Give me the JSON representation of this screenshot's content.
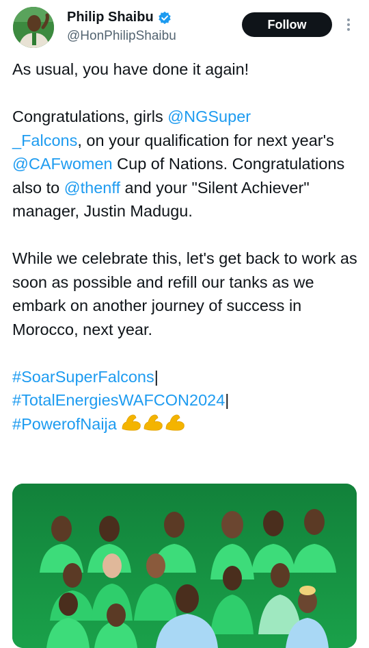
{
  "author": {
    "display_name": "Philip Shaibu",
    "handle": "@HonPhilipShaibu",
    "verified": true,
    "avatar_icon": "avatar-photo"
  },
  "follow_label": "Follow",
  "more_icon": "vertical-dots-icon",
  "tweet": {
    "p1": "As usual, you have done it again!",
    "p2_a": "Congratulations, girls ",
    "p2_mention1a": "@NGSuper",
    "p2_mention1b": "_Falcons",
    "p2_b": ", on your qualification for next year's ",
    "p2_mention2": "@CAFwomen",
    "p2_c": "  Cup of Nations. Congratulations also to ",
    "p2_mention3": "@thenff",
    "p2_d": " and your \"Silent Achiever\" manager, Justin Madugu.",
    "p3": "While we celebrate this, let's get back to work as soon as possible and refill our tanks as we embark on another journey of success in Morocco, next year.",
    "hashtag1": "#SoarSuperFalcons",
    "hashtag2": "#TotalEnergiesWAFCON2024",
    "hashtag3": "#PowerofNaija",
    "sep": "|",
    "emoji_name": "flexed-biceps-icon"
  },
  "media": {
    "icon": "team-photo"
  },
  "colors": {
    "link": "#1d9bf0",
    "text": "#0f1419",
    "secondary": "#536471",
    "pitch": "#13893e"
  }
}
